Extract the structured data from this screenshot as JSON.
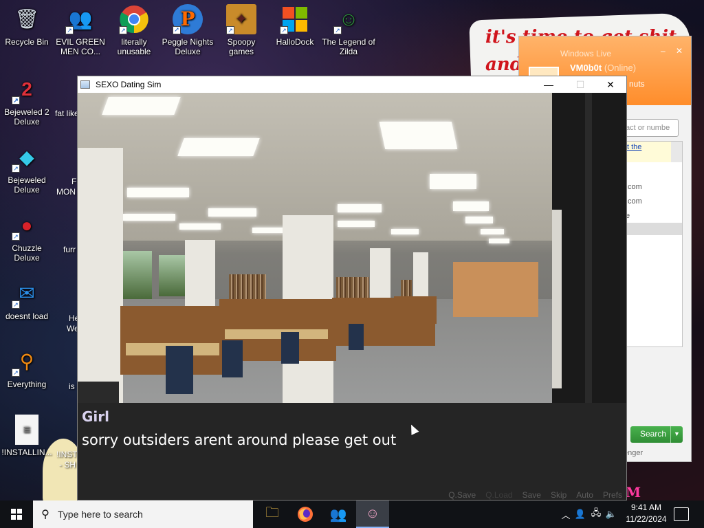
{
  "desktop": {
    "wallpaper_text": "it's time to get shit and",
    "icons": [
      {
        "label": "Recycle Bin",
        "glyph": "🗑",
        "icon": "recycle-bin-icon"
      },
      {
        "label": "EVIL GREEN MEN CO...",
        "glyph": "👥",
        "icon": "messenger-buddies-icon"
      },
      {
        "label": "literally unusable",
        "glyph": "◉",
        "icon": "chrome-icon"
      },
      {
        "label": "Peggle Nights Deluxe",
        "glyph": "P",
        "icon": "peggle-icon"
      },
      {
        "label": "Spoopy games",
        "glyph": "📁",
        "icon": "folder-icon"
      },
      {
        "label": "HalloDock",
        "glyph": "⊞",
        "icon": "windows-logo-icon"
      },
      {
        "label": "The Legend of Zilda",
        "glyph": "☺",
        "icon": "zelda-icon"
      },
      {
        "label": "Bejeweled 2 Deluxe",
        "glyph": "◆",
        "icon": "bejeweled-2-icon"
      },
      {
        "label": "Bejeweled Deluxe",
        "glyph": "◆",
        "icon": "bejeweled-icon"
      },
      {
        "label": "Chuzzle Deluxe",
        "glyph": "●",
        "icon": "chuzzle-icon"
      },
      {
        "label": "doesnt load",
        "glyph": "🐦",
        "icon": "thunderbird-icon"
      },
      {
        "label": "Everything",
        "glyph": "⚲",
        "icon": "everything-search-icon"
      },
      {
        "label": "!INSTALLIN...",
        "glyph": "📄",
        "icon": "document-icon"
      }
    ],
    "cut_labels": [
      "fat like",
      "F",
      "MON",
      "furr",
      "He",
      "We",
      "is",
      "!INST",
      "- SH"
    ]
  },
  "messenger": {
    "title": "Windows Live",
    "username": "VM0b0t",
    "status": "(Online)",
    "personal_message": "nuts",
    "search_placeholder": "act or numbe",
    "ad_text": "t the",
    "entries": [
      ".com",
      ".com",
      "e"
    ],
    "search_button": "Search",
    "footer": "enger"
  },
  "game": {
    "window_title": "SEXO Dating Sim",
    "speaker": "Girl",
    "dialogue": "sorry outsiders arent around please get out",
    "quick_menu": [
      "Q.Save",
      "Q.Load",
      "Save",
      "Skip",
      "Auto",
      "Prefs"
    ]
  },
  "taskbar": {
    "search_placeholder": "Type here to search",
    "time": "9:41 AM",
    "date": "11/22/2024"
  },
  "colors": {
    "dialog_bg": "#282828",
    "speaker": "#d9d2ef",
    "taskbar": "#101216",
    "messenger_accent": "#ff8d2b",
    "search_button": "#3a9e3f"
  }
}
